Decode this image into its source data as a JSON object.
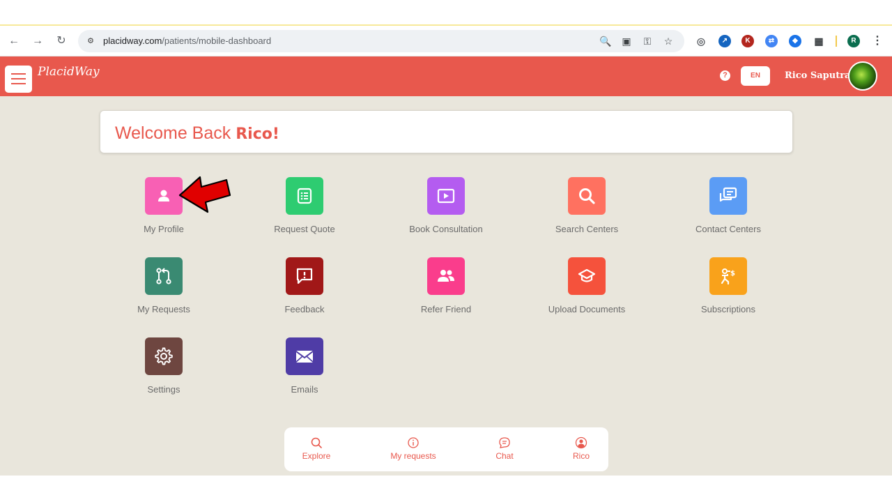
{
  "browser": {
    "url_domain": "placidway.com",
    "url_path": "/patients/mobile-dashboard",
    "extension_badge": "K",
    "profile_badge": "R"
  },
  "header": {
    "logo_text": "PlacidWay",
    "help_label": "?",
    "language": "EN",
    "user_name": "Rico Saputra"
  },
  "welcome": {
    "prefix": "Welcome Back ",
    "name": "Rico!"
  },
  "tiles": [
    {
      "label": "My Profile",
      "color": "#f860b4",
      "icon": "user-icon"
    },
    {
      "label": "Request Quote",
      "color": "#2ecc71",
      "icon": "list-icon"
    },
    {
      "label": "Book Consultation",
      "color": "#b45cf0",
      "icon": "play-icon"
    },
    {
      "label": "Search Centers",
      "color": "#ff7160",
      "icon": "search-icon"
    },
    {
      "label": "Contact Centers",
      "color": "#5b9cf5",
      "icon": "chat-icon"
    },
    {
      "label": "My Requests",
      "color": "#3a8a72",
      "icon": "pull-request-icon"
    },
    {
      "label": "Feedback",
      "color": "#a11818",
      "icon": "feedback-icon"
    },
    {
      "label": "Refer Friend",
      "color": "#fa3d8c",
      "icon": "users-icon"
    },
    {
      "label": "Upload Documents",
      "color": "#f5523c",
      "icon": "graduation-cap-icon"
    },
    {
      "label": "Subscriptions",
      "color": "#f9a21b",
      "icon": "subscription-icon"
    },
    {
      "label": "Settings",
      "color": "#6e4640",
      "icon": "gear-icon"
    },
    {
      "label": "Emails",
      "color": "#4f3ca6",
      "icon": "envelope-icon"
    }
  ],
  "bottom_nav": [
    {
      "label": "Explore",
      "icon": "search-icon"
    },
    {
      "label": "My requests",
      "icon": "info-icon"
    },
    {
      "label": "Chat",
      "icon": "chat-bubble-icon"
    },
    {
      "label": "Rico",
      "icon": "user-circle-icon"
    }
  ],
  "colors": {
    "brand": "#e8584d",
    "background": "#e9e6dc",
    "annotation_arrow": "#e00000"
  }
}
